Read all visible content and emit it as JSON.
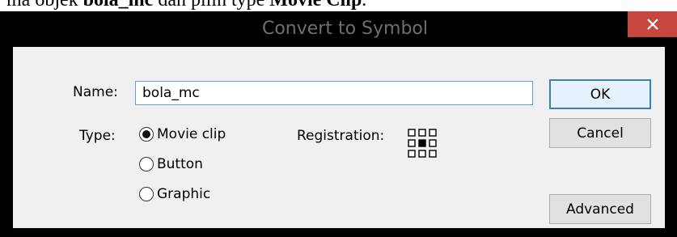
{
  "caption": {
    "part1": "ma objek ",
    "bold1": "bola_mc",
    "part2": " dan pilih type ",
    "bold2": "Movie Clip",
    "part3": "."
  },
  "dialog": {
    "title": "Convert to Symbol",
    "close_icon": "close-icon",
    "name_label": "Name:",
    "name_value": "bola_mc",
    "type_label": "Type:",
    "types": [
      {
        "label": "Movie clip",
        "selected": true
      },
      {
        "label": "Button",
        "selected": false
      },
      {
        "label": "Graphic",
        "selected": false
      }
    ],
    "registration_label": "Registration:",
    "registration_icon": "registration-grid-icon",
    "buttons": {
      "ok": "OK",
      "cancel": "Cancel",
      "advanced": "Advanced"
    }
  },
  "colors": {
    "close_bg": "#c7463f",
    "client_bg": "#f0f0f0",
    "focus_border": "#3c7fb1"
  }
}
